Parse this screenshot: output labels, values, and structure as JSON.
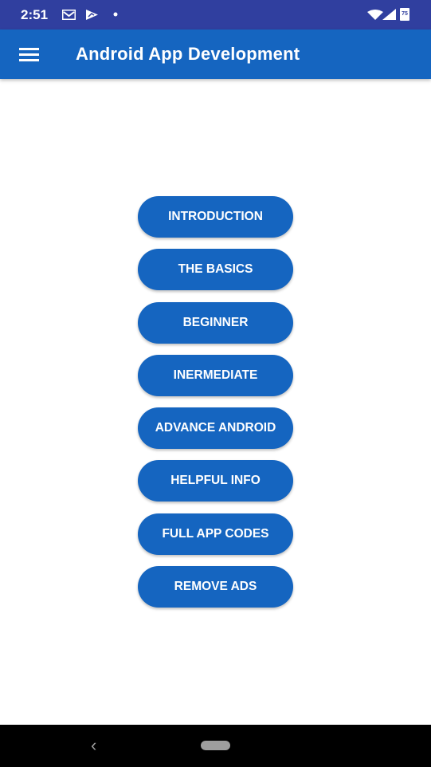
{
  "status_bar": {
    "time": "2:51",
    "icons": [
      "gmail-icon",
      "play-store-icon",
      "notification-dot-icon",
      "wifi-icon",
      "signal-icon",
      "battery-icon"
    ],
    "battery_level": "75"
  },
  "app_bar": {
    "menu_icon": "hamburger-menu-icon",
    "title": "Android App Development"
  },
  "menu_buttons": [
    {
      "label": "INTRODUCTION"
    },
    {
      "label": "THE BASICS"
    },
    {
      "label": "BEGINNER"
    },
    {
      "label": "INERMEDIATE"
    },
    {
      "label": "ADVANCE ANDROID"
    },
    {
      "label": "HELPFUL INFO"
    },
    {
      "label": "FULL APP CODES"
    },
    {
      "label": "REMOVE ADS"
    }
  ],
  "nav_bar": {
    "back_glyph": "‹"
  },
  "colors": {
    "status_bar": "#303f9f",
    "primary": "#1565c0",
    "nav_bar": "#000000"
  }
}
